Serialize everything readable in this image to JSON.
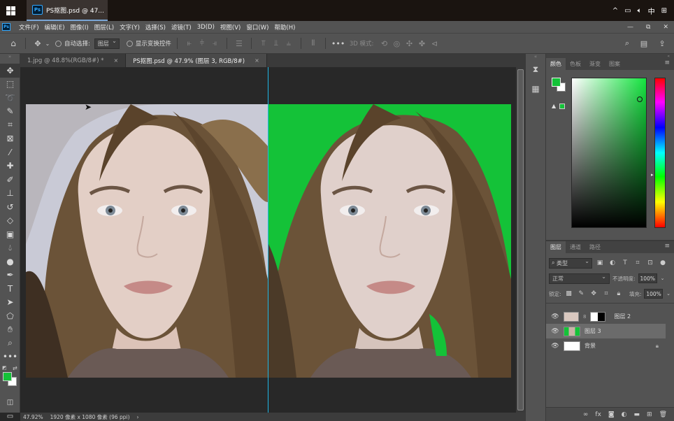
{
  "taskbar": {
    "app_badge": "Ps",
    "app_title": "PS抠图.psd @ 47...",
    "tray": {
      "caret": "^",
      "ime": "中",
      "grid": "⊞"
    }
  },
  "menubar": {
    "logo": "Ps",
    "items": [
      "文件(F)",
      "编辑(E)",
      "图像(I)",
      "图层(L)",
      "文字(Y)",
      "选择(S)",
      "滤镜(T)",
      "3D(D)",
      "视图(V)",
      "窗口(W)",
      "帮助(H)"
    ],
    "window_controls": {
      "minimize": "—",
      "restore": "⧉",
      "close": "✕"
    }
  },
  "options": {
    "auto_select_label": "自动选择:",
    "auto_select_value": "图层",
    "show_transform_label": "显示变换控件",
    "mode_3d_label": "3D 模式:"
  },
  "tabs": [
    {
      "label": "1.jpg @ 48.8%(RGB/8#) *",
      "close": "×",
      "active": false
    },
    {
      "label": "PS抠图.psd @ 47.9% (图层 3, RGB/8#)",
      "close": "×",
      "active": true
    }
  ],
  "status": {
    "zoom": "47.92%",
    "doc_info": "1920 像素 x 1080 像素 (96 ppi)",
    "arrow": "›"
  },
  "color_panel": {
    "tabs": [
      "颜色",
      "色板",
      "渐变",
      "图案"
    ],
    "foreground": "#14c238",
    "background": "#ffffff",
    "warning_icon": "▲"
  },
  "layers_panel": {
    "tabs": [
      "图层",
      "通道",
      "路径"
    ],
    "filter_label": "类型",
    "blend_mode": "正常",
    "opacity_label": "不透明度:",
    "opacity_value": "100%",
    "lock_label": "锁定:",
    "fill_label": "填充:",
    "fill_value": "100%",
    "layers": [
      {
        "name": "图层 2",
        "visible": true,
        "selected": false
      },
      {
        "name": "图层 3",
        "visible": true,
        "selected": true
      },
      {
        "name": "背景",
        "visible": true,
        "selected": false,
        "locked": true
      }
    ],
    "footer_icons": [
      "link-icon",
      "fx-icon",
      "mask-icon",
      "adjustment-icon",
      "group-icon",
      "new-layer-icon",
      "delete-icon"
    ]
  },
  "canvas": {
    "left_bg": "#c9cad6",
    "right_bg": "#14c238"
  }
}
